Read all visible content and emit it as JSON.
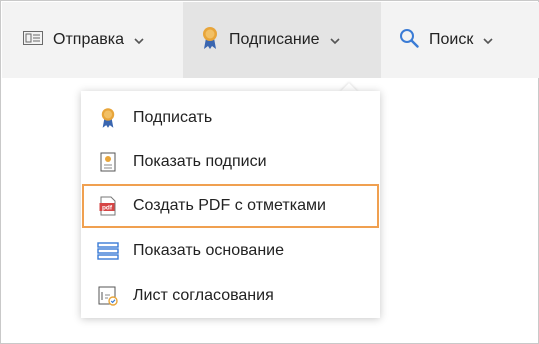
{
  "toolbar": {
    "send_label": "Отправка",
    "sign_label": "Подписание",
    "search_label": "Поиск"
  },
  "menu": {
    "items": [
      {
        "label": "Подписать",
        "icon": "medal-icon"
      },
      {
        "label": "Показать подписи",
        "icon": "certificate-icon"
      },
      {
        "label": "Создать PDF с отметками",
        "icon": "pdf-icon",
        "icon_text": "pdf"
      },
      {
        "label": "Показать основание",
        "icon": "stack-icon"
      },
      {
        "label": "Лист согласования",
        "icon": "approval-sheet-icon"
      }
    ]
  },
  "colors": {
    "accent": "#f0a050",
    "medal": "#e8a53a",
    "ribbon": "#3a66b0",
    "icon_blue": "#3a7bd5",
    "pdf_red": "#d64545"
  }
}
